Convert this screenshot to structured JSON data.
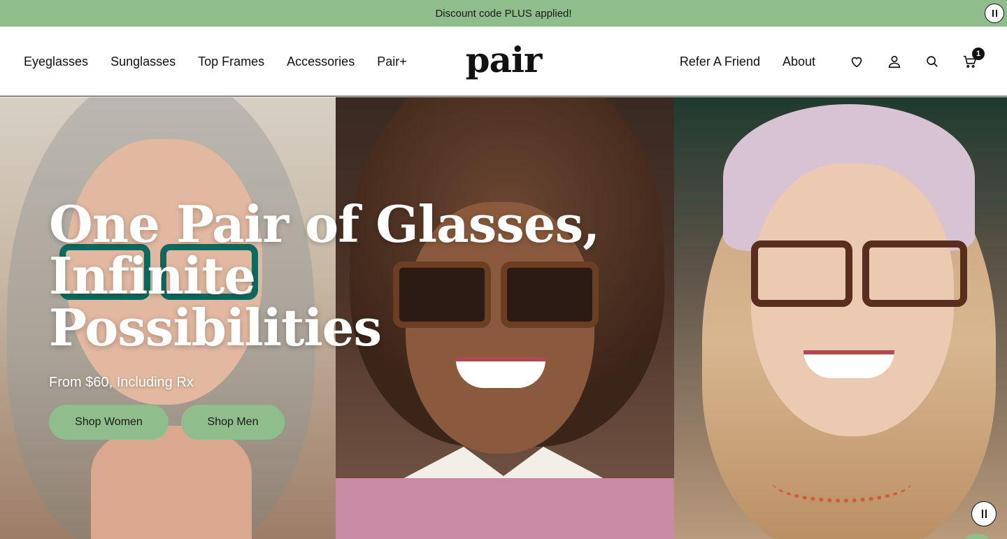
{
  "announcement": {
    "text": "Discount code PLUS applied!"
  },
  "header": {
    "logo": "pair",
    "nav_left": [
      "Eyeglasses",
      "Sunglasses",
      "Top Frames",
      "Accessories",
      "Pair+"
    ],
    "nav_right": [
      "Refer A Friend",
      "About"
    ],
    "icons": [
      "heart-icon",
      "user-icon",
      "search-icon",
      "cart-icon"
    ],
    "cart_count": "1"
  },
  "hero": {
    "headline_line1": "One Pair of Glasses,",
    "headline_line2": "Infinite",
    "headline_line3": "Possibilities",
    "subline": "From $60, Including Rx",
    "cta_women": "Shop Women",
    "cta_men": "Shop Men"
  },
  "colors": {
    "accent": "#8fbd8c",
    "text": "#111111"
  }
}
